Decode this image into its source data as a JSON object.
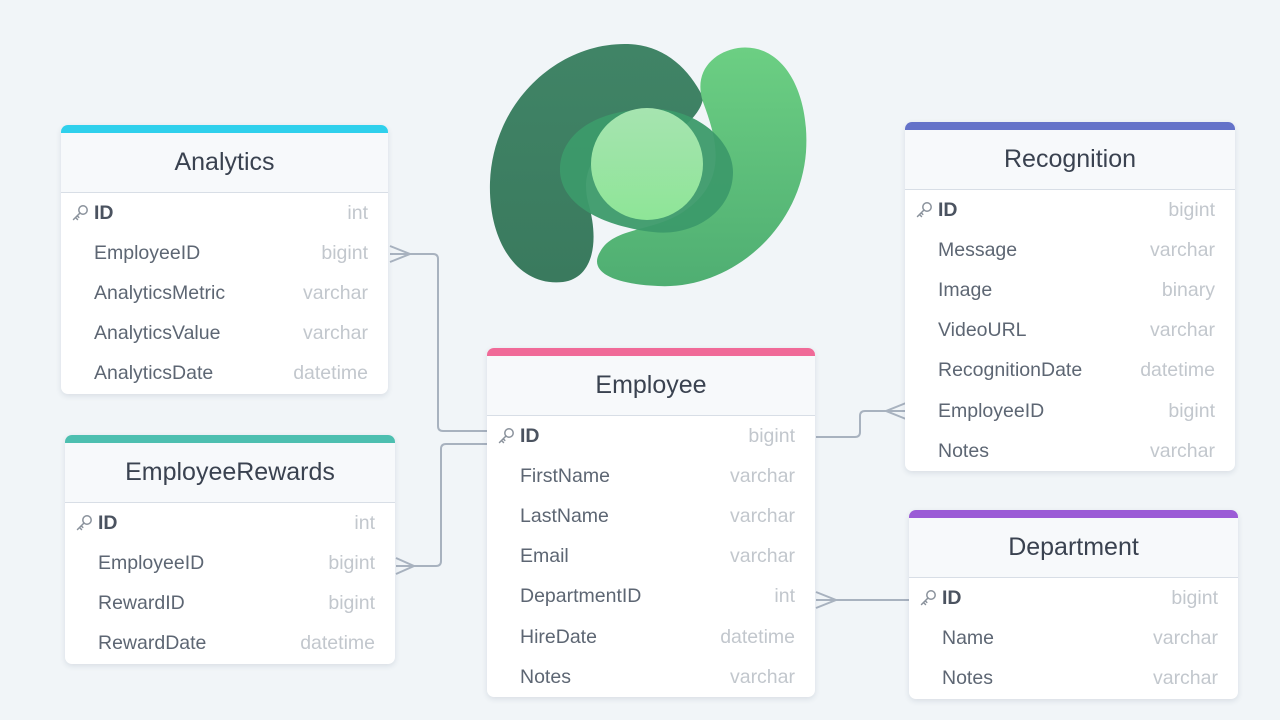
{
  "diagram": {
    "colors": {
      "background": "#f1f5f8",
      "connector": "#a8b2bf",
      "analytics": "#2fd0ec",
      "employee_rewards": "#4dbfb0",
      "employee": "#f06a98",
      "recognition": "#6472c9",
      "department": "#9b5bd6"
    },
    "tables": {
      "analytics": {
        "title": "Analytics",
        "fields": [
          {
            "name": "ID",
            "type": "int",
            "pk": true
          },
          {
            "name": "EmployeeID",
            "type": "bigint"
          },
          {
            "name": "AnalyticsMetric",
            "type": "varchar"
          },
          {
            "name": "AnalyticsValue",
            "type": "varchar"
          },
          {
            "name": "AnalyticsDate",
            "type": "datetime"
          }
        ]
      },
      "employee_rewards": {
        "title": "EmployeeRewards",
        "fields": [
          {
            "name": "ID",
            "type": "int",
            "pk": true
          },
          {
            "name": "EmployeeID",
            "type": "bigint"
          },
          {
            "name": "RewardID",
            "type": "bigint"
          },
          {
            "name": "RewardDate",
            "type": "datetime"
          }
        ]
      },
      "employee": {
        "title": "Employee",
        "fields": [
          {
            "name": "ID",
            "type": "bigint",
            "pk": true
          },
          {
            "name": "FirstName",
            "type": "varchar"
          },
          {
            "name": "LastName",
            "type": "varchar"
          },
          {
            "name": "Email",
            "type": "varchar"
          },
          {
            "name": "DepartmentID",
            "type": "int"
          },
          {
            "name": "HireDate",
            "type": "datetime"
          },
          {
            "name": "Notes",
            "type": "varchar"
          }
        ]
      },
      "recognition": {
        "title": "Recognition",
        "fields": [
          {
            "name": "ID",
            "type": "bigint",
            "pk": true
          },
          {
            "name": "Message",
            "type": "varchar"
          },
          {
            "name": "Image",
            "type": "binary"
          },
          {
            "name": "VideoURL",
            "type": "varchar"
          },
          {
            "name": "RecognitionDate",
            "type": "datetime"
          },
          {
            "name": "EmployeeID",
            "type": "bigint"
          },
          {
            "name": "Notes",
            "type": "varchar"
          }
        ]
      },
      "department": {
        "title": "Department",
        "fields": [
          {
            "name": "ID",
            "type": "bigint",
            "pk": true
          },
          {
            "name": "Name",
            "type": "varchar"
          },
          {
            "name": "Notes",
            "type": "varchar"
          }
        ]
      }
    },
    "relationships": [
      {
        "from": "Analytics.EmployeeID",
        "to": "Employee.ID",
        "cardinality": "many-to-one"
      },
      {
        "from": "EmployeeRewards.EmployeeID",
        "to": "Employee.ID",
        "cardinality": "many-to-one"
      },
      {
        "from": "Recognition.EmployeeID",
        "to": "Employee.ID",
        "cardinality": "many-to-one"
      },
      {
        "from": "Employee.DepartmentID",
        "to": "Department.ID",
        "cardinality": "many-to-one"
      }
    ],
    "logo": "dataverse-logo"
  }
}
